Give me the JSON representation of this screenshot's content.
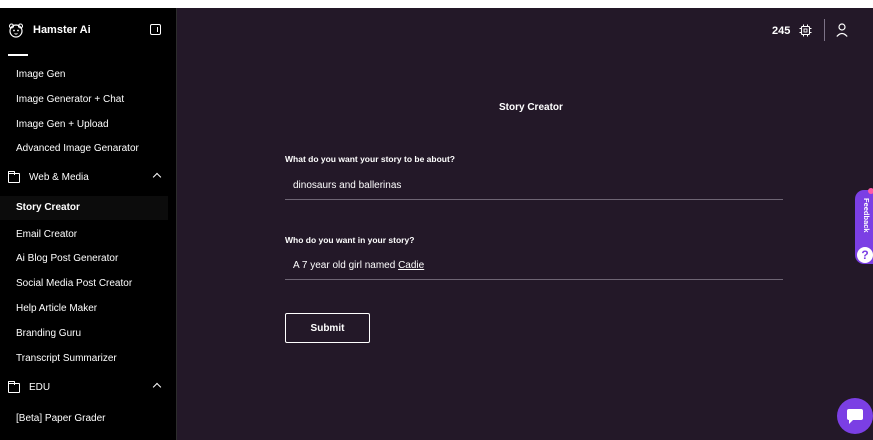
{
  "sidebar": {
    "brand": "Hamster Ai",
    "items_top": [
      {
        "label": "Image Gen"
      },
      {
        "label": "Image Generator + Chat"
      },
      {
        "label": "Image Gen + Upload"
      },
      {
        "label": "Advanced Image Genarator"
      }
    ],
    "section_web": {
      "label": "Web & Media"
    },
    "items_web": [
      {
        "label": "Story Creator",
        "active": true
      },
      {
        "label": "Email Creator"
      },
      {
        "label": "Ai Blog Post Generator"
      },
      {
        "label": "Social Media Post Creator"
      },
      {
        "label": "Help Article Maker"
      },
      {
        "label": "Branding Guru"
      },
      {
        "label": "Transcript Summarizer"
      }
    ],
    "section_edu": {
      "label": "EDU"
    },
    "items_edu": [
      {
        "label": "[Beta] Paper Grader"
      }
    ]
  },
  "topbar": {
    "credits": "245"
  },
  "form": {
    "title": "Story Creator",
    "q1_label": "What do you want your story to be about?",
    "q1_value": "dinosaurs and ballerinas",
    "q2_label": "Who do you want in your story?",
    "q2_value_prefix": "A 7 year old girl named ",
    "q2_value_name": "Cadie",
    "submit_label": "Submit"
  },
  "feedback": {
    "label": "Feedback",
    "help_glyph": "?"
  },
  "colors": {
    "main_bg": "#231828",
    "sidebar_bg": "#000000",
    "accent": "#7b3fe4"
  }
}
